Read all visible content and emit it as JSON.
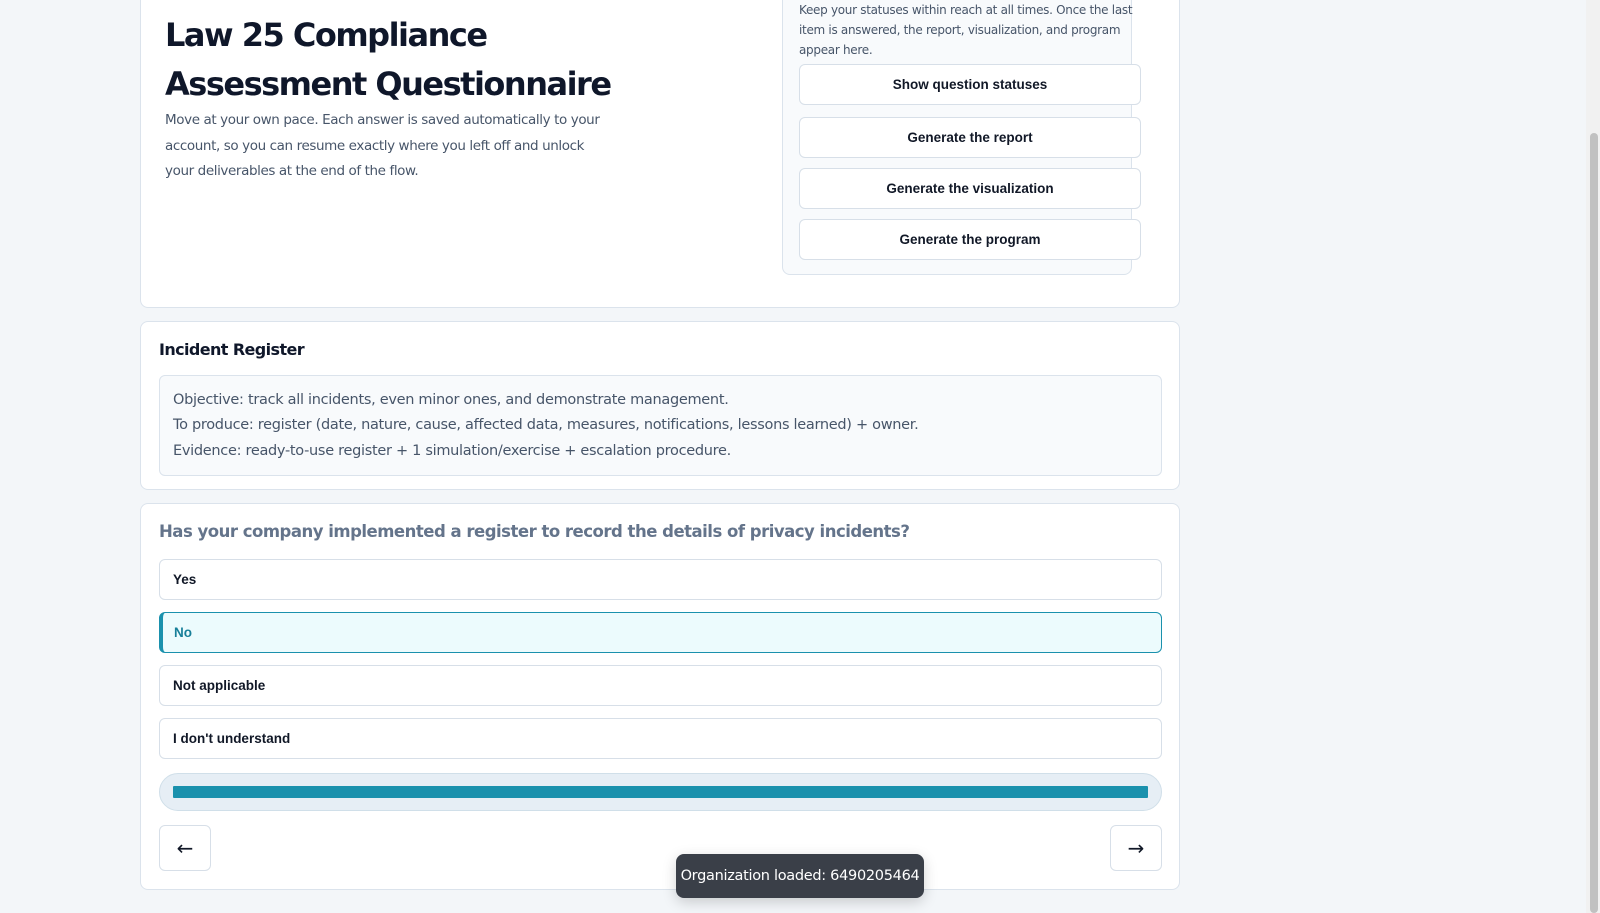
{
  "hero": {
    "title": "Law 25 Compliance Assessment Questionnaire",
    "description": "Move at your own pace. Each answer is saved automatically to your account, so you can resume exactly where you left off and unlock your deliverables at the end of the flow."
  },
  "side_panel": {
    "text": "Keep your statuses within reach at all times. Once the last item is answered, the report, visualization, and program appear here.",
    "buttons": {
      "statuses": "Show question statuses",
      "report": "Generate the report",
      "visualization": "Generate the visualization",
      "program": "Generate the program"
    }
  },
  "section": {
    "title": "Incident Register",
    "lines": [
      "Objective: track all incidents, even minor ones, and demonstrate management.",
      "To produce: register (date, nature, cause, affected data, measures, notifications, lessons learned) + owner.",
      "Evidence: ready-to-use register + 1 simulation/exercise + escalation procedure."
    ]
  },
  "question": {
    "text": "Has your company implemented a register to record the details of privacy incidents?",
    "options": [
      "Yes",
      "No",
      "Not applicable",
      "I don't understand"
    ],
    "selected": "No"
  },
  "progress": {
    "fraction": 1.0
  },
  "navigation": {
    "prev": "←",
    "next": "→"
  },
  "toast": {
    "text": "Organization loaded: 6490205464"
  },
  "colors": {
    "accent": "#1a91ad",
    "selected_bg": "#ecfbfd",
    "page_bg": "#f3f6f9"
  }
}
